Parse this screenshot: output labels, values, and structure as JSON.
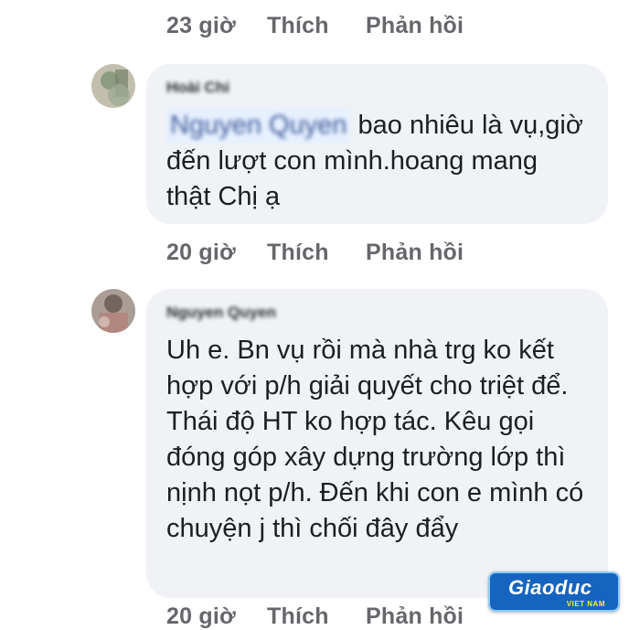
{
  "thread": {
    "top_actions": {
      "time": "23 giờ",
      "like": "Thích",
      "reply": "Phản hồi"
    },
    "comments": [
      {
        "author": "Hoài Chi",
        "mention": "Nguyen Quyen",
        "text": "bao nhiêu là vụ,giờ đến lượt con mình.hoang mang thật Chị ạ",
        "actions": {
          "time": "20 giờ",
          "like": "Thích",
          "reply": "Phản hồi"
        }
      },
      {
        "author": "Nguyen Quyen",
        "text": "Uh e. Bn vụ rồi mà nhà trg ko kết hợp với p/h giải quyết cho triệt để. Thái độ HT ko hợp tác. Kêu gọi đóng góp xây dựng trường lớp thì nịnh nọt p/h. Đến khi con e mình có chuyện j thì chối đây đẩy",
        "actions": {
          "time": "20 giờ",
          "like": "Thích",
          "reply": "Phản hồi"
        }
      }
    ]
  },
  "watermark": {
    "main": "Giaoduc",
    "sub": "VIET NAM"
  },
  "colors": {
    "bubble": "#f0f2f5",
    "action_text": "#65676b",
    "body_text": "#1c1e21"
  },
  "icons": [
    "avatar-1",
    "avatar-2",
    "giaoduc-logo"
  ]
}
